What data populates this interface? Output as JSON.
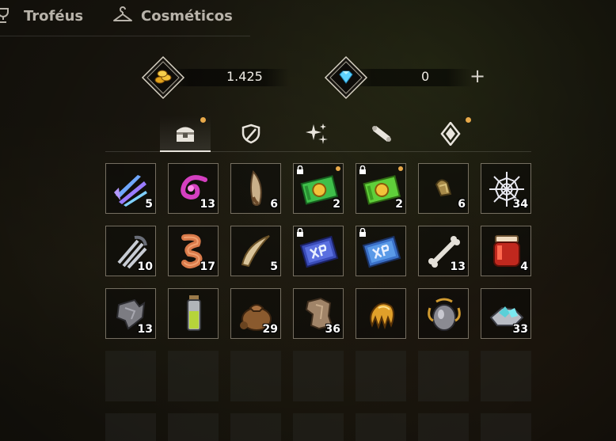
{
  "top_tabs": [
    {
      "label": "Troféus",
      "icon": "trophy-icon"
    },
    {
      "label": "Cosméticos",
      "icon": "hanger-icon"
    }
  ],
  "currencies": {
    "gold": {
      "value": "1.425",
      "icon": "gold-coins-icon"
    },
    "gems": {
      "value": "0",
      "icon": "diamond-gem-icon",
      "add_label": "+"
    }
  },
  "category_tabs": [
    {
      "icon": "chest-icon",
      "active": true,
      "notification": true
    },
    {
      "icon": "shield-sword-icon",
      "active": false,
      "notification": false
    },
    {
      "icon": "sparkles-icon",
      "active": false,
      "notification": false
    },
    {
      "icon": "scroll-icon",
      "active": false,
      "notification": false
    },
    {
      "icon": "crystal-icon",
      "active": false,
      "notification": true
    }
  ],
  "items": [
    {
      "icon": "claw-blue-icon",
      "qty": "5"
    },
    {
      "icon": "purple-swirl-icon",
      "qty": "13"
    },
    {
      "icon": "fang-icon",
      "qty": "6"
    },
    {
      "icon": "gold-ticket-icon",
      "qty": "2",
      "locked": true,
      "notification": true
    },
    {
      "icon": "gold-ticket-icon",
      "qty": "2",
      "locked": true,
      "notification": true
    },
    {
      "icon": "nut-icon",
      "qty": "6"
    },
    {
      "icon": "spider-web-icon",
      "qty": "34"
    },
    {
      "icon": "spring-coil-icon",
      "qty": "10"
    },
    {
      "icon": "worm-icon",
      "qty": "17"
    },
    {
      "icon": "horn-icon",
      "qty": "5"
    },
    {
      "icon": "xp-ticket-icon",
      "qty": "",
      "locked": true
    },
    {
      "icon": "xp-ticket-icon",
      "qty": "",
      "locked": true
    },
    {
      "icon": "bone-icon",
      "qty": "13"
    },
    {
      "icon": "jam-jar-icon",
      "qty": "4"
    },
    {
      "icon": "cloth-scrap-icon",
      "qty": "13"
    },
    {
      "icon": "potion-vial-icon",
      "qty": ""
    },
    {
      "icon": "pouch-icon",
      "qty": "29"
    },
    {
      "icon": "leather-hide-icon",
      "qty": "36"
    },
    {
      "icon": "golden-claw-icon",
      "qty": ""
    },
    {
      "icon": "silver-urn-icon",
      "qty": ""
    },
    {
      "icon": "crystal-ore-icon",
      "qty": "33"
    }
  ],
  "colors": {
    "accent_dot": "#e8a94a",
    "panel_border": "#c8beaa"
  }
}
